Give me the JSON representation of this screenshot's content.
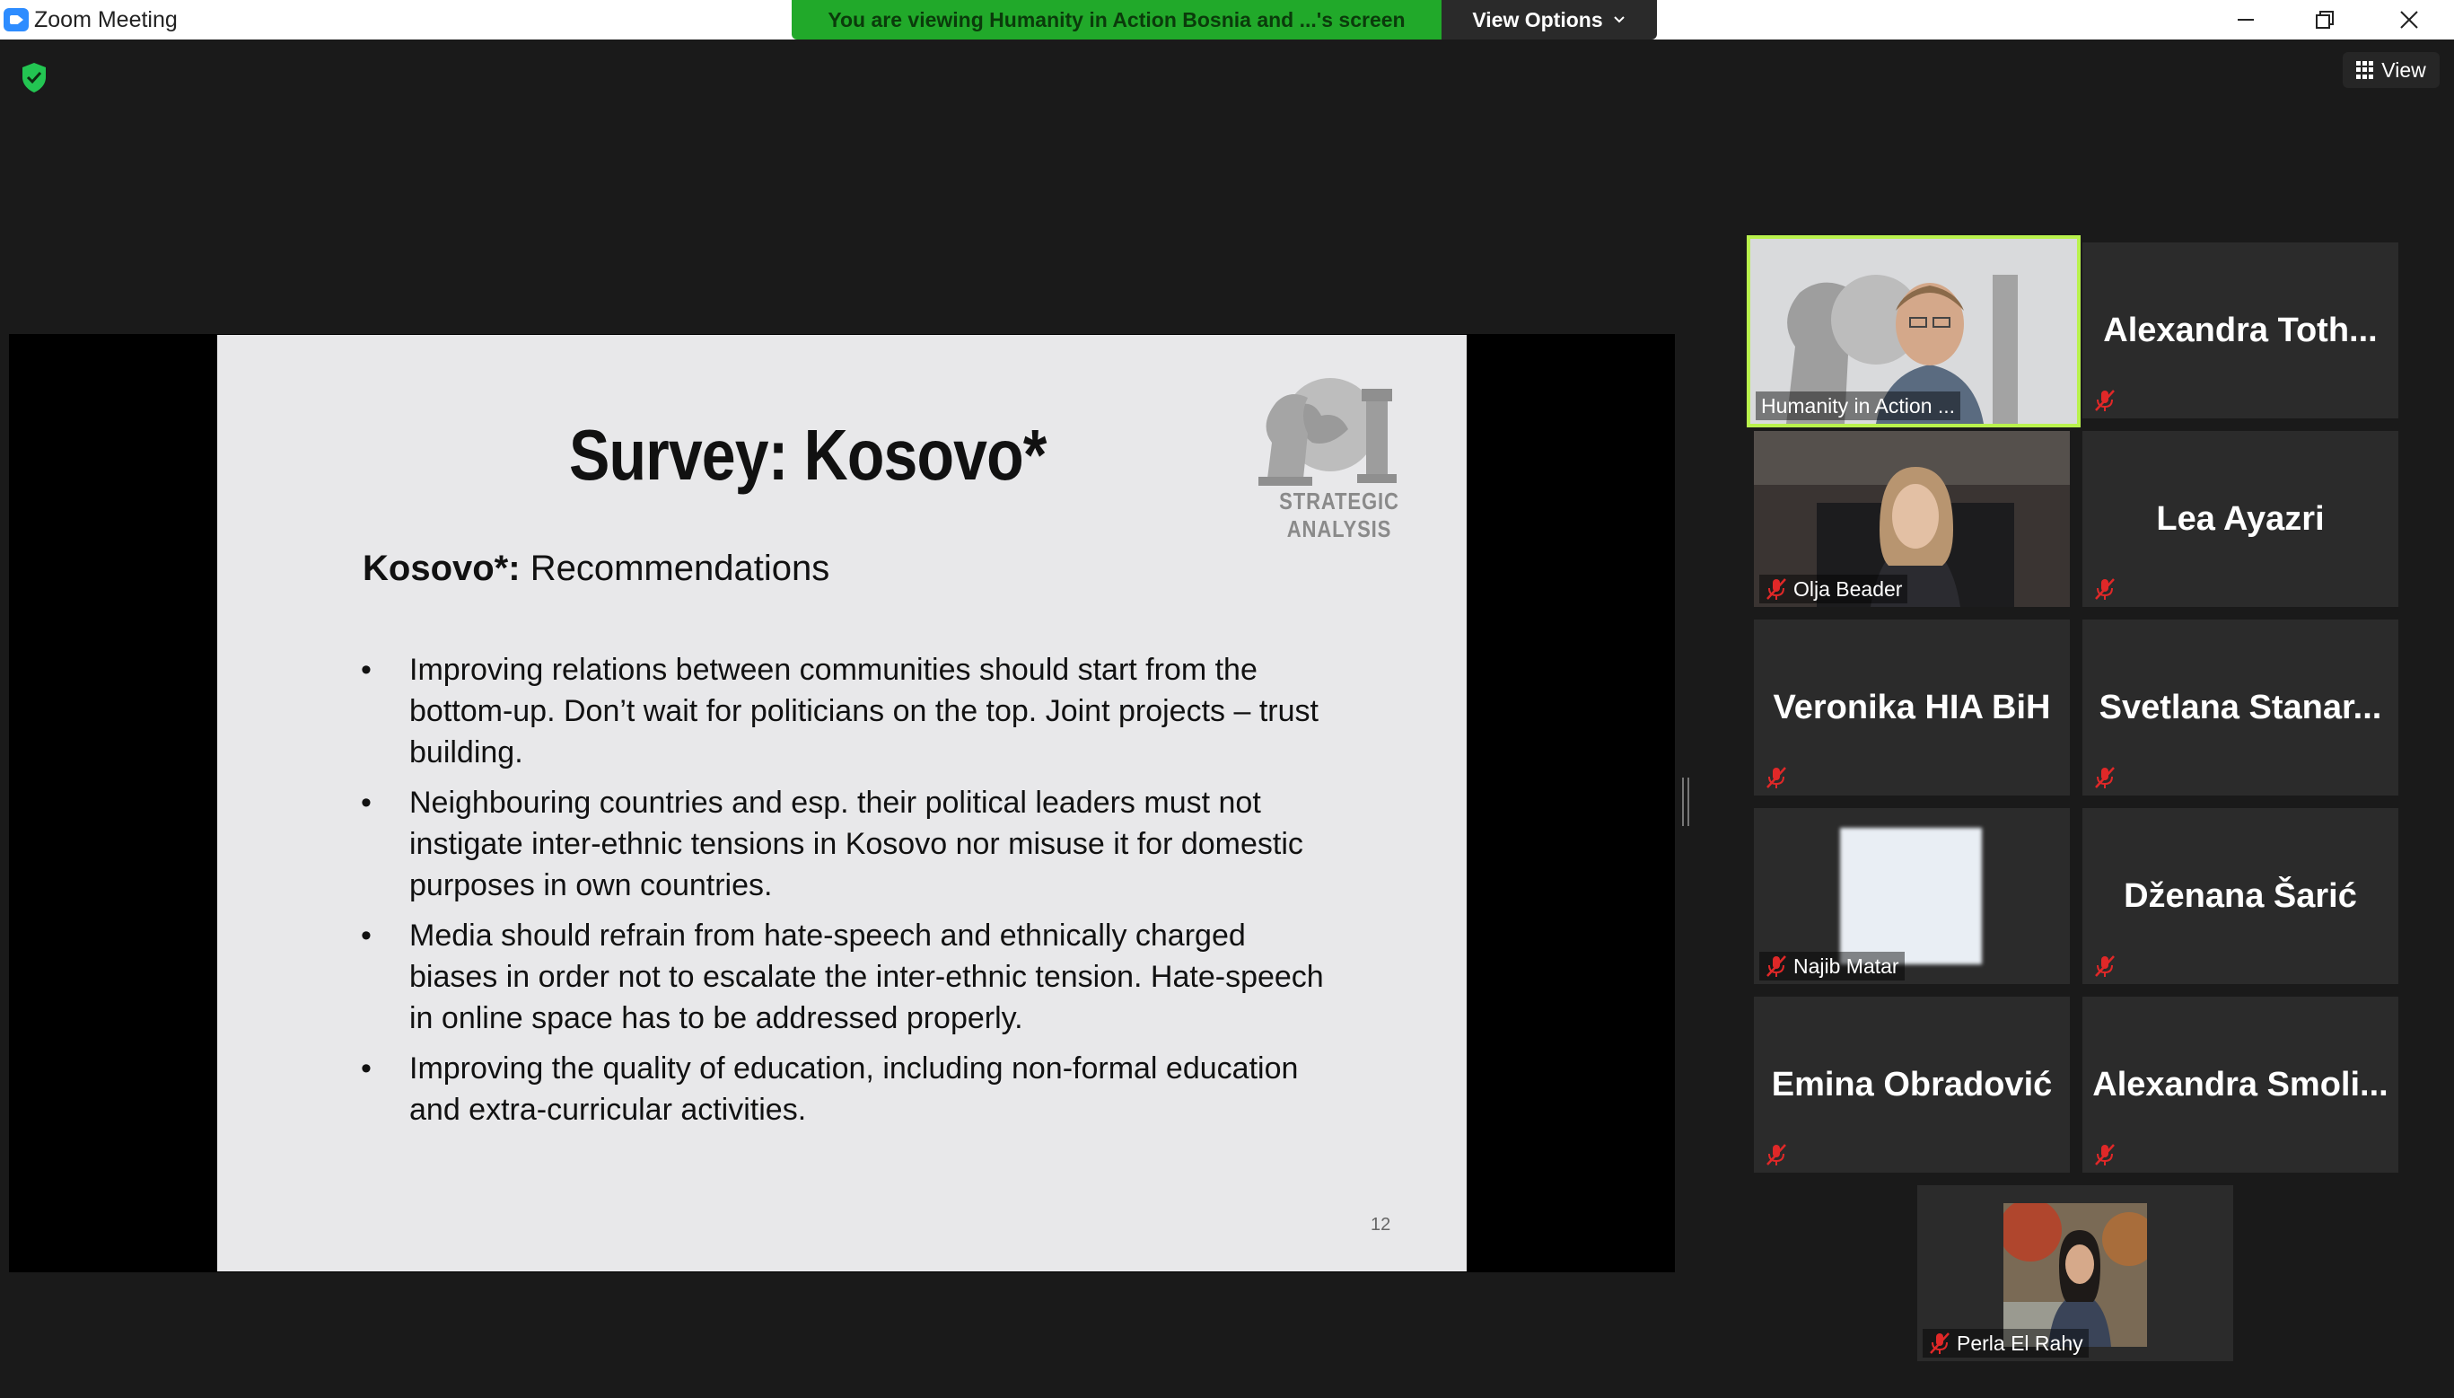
{
  "window": {
    "title": "Zoom Meeting",
    "banner": "You are viewing Humanity in Action Bosnia and ...'s screen",
    "view_options": "View Options",
    "view_button": "View"
  },
  "slide": {
    "title": "Survey: Kosovo*",
    "logo_text": "STRATEGIC ANALYSIS",
    "subtitle_bold": "Kosovo*:",
    "subtitle_rest": "Recommendations",
    "bullets": [
      "Improving relations between communities should start from the bottom-up. Don’t wait for politicians on the top. Joint projects – trust building.",
      "Neighbouring countries and esp. their political leaders must not instigate inter-ethnic tensions in Kosovo nor misuse it for domestic purposes in own countries.",
      "Media should refrain from hate-speech and ethnically charged biases in order not to escalate the inter-ethnic tension. Hate-speech in online space has to be addressed properly.",
      "Improving the quality of education, including non-formal education and extra-curricular activities."
    ],
    "page_number": "12"
  },
  "participants": {
    "p1": {
      "label": "Humanity in Action ...",
      "muted": false,
      "video": true,
      "active_speaker": true
    },
    "p2": {
      "display": "Alexandra  Toth...",
      "muted": true,
      "video": false
    },
    "p3": {
      "label": "Olja Beader",
      "muted": true,
      "video": true
    },
    "p4": {
      "display": "Lea Ayazri",
      "muted": true,
      "video": false
    },
    "p5": {
      "display": "Veronika HIA BiH",
      "muted": true,
      "video": false
    },
    "p6": {
      "display": "Svetlana  Stanar...",
      "muted": true,
      "video": false
    },
    "p7": {
      "label": "Najib Matar",
      "muted": true,
      "video": true
    },
    "p8": {
      "display": "Dženana Šarić",
      "muted": true,
      "video": false
    },
    "p9": {
      "display": "Emina Obradović",
      "muted": true,
      "video": false
    },
    "p10": {
      "display": "Alexandra  Smoli...",
      "muted": true,
      "video": false
    },
    "p11": {
      "label": "Perla El Rahy",
      "muted": true,
      "video": true
    }
  },
  "colors": {
    "banner_green": "#21a92a",
    "active_speaker_outline": "#b9f24d",
    "mute_red": "#e02828",
    "slide_bg": "#e8e8ea"
  }
}
